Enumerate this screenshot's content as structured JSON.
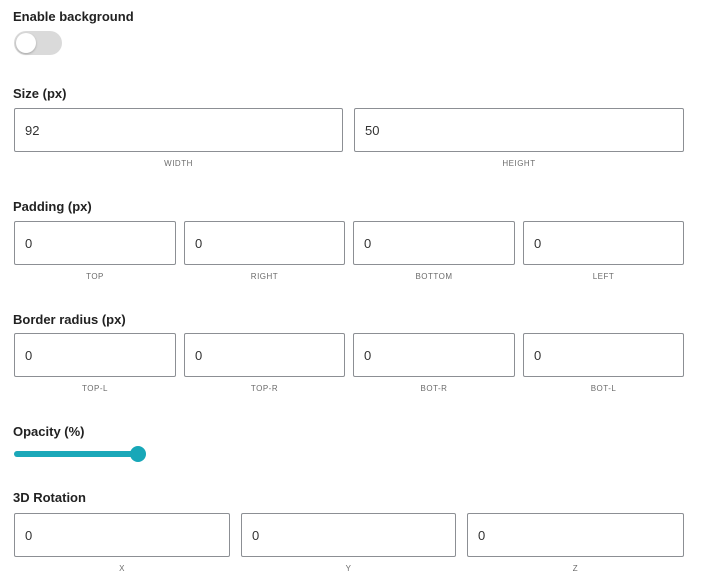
{
  "background": {
    "label": "Enable background",
    "enabled": false
  },
  "size": {
    "label": "Size (px)",
    "width": {
      "value": "92",
      "caption": "WIDTH"
    },
    "height": {
      "value": "50",
      "caption": "HEIGHT"
    }
  },
  "padding": {
    "label": "Padding (px)",
    "top": {
      "value": "0",
      "caption": "TOP"
    },
    "right": {
      "value": "0",
      "caption": "RIGHT"
    },
    "bottom": {
      "value": "0",
      "caption": "BOTTOM"
    },
    "left": {
      "value": "0",
      "caption": "LEFT"
    }
  },
  "radius": {
    "label": "Border radius (px)",
    "top_left": {
      "value": "0",
      "caption": "TOP-L"
    },
    "top_right": {
      "value": "0",
      "caption": "TOP-R"
    },
    "bottom_right": {
      "value": "0",
      "caption": "BOT-R"
    },
    "bottom_left": {
      "value": "0",
      "caption": "BOT-L"
    }
  },
  "opacity": {
    "label": "Opacity (%)",
    "value": 100,
    "accent_color": "#17a7b8"
  },
  "rotation": {
    "label": "3D Rotation",
    "x": {
      "value": "0",
      "caption": "X"
    },
    "y": {
      "value": "0",
      "caption": "Y"
    },
    "z": {
      "value": "0",
      "caption": "Z"
    }
  }
}
